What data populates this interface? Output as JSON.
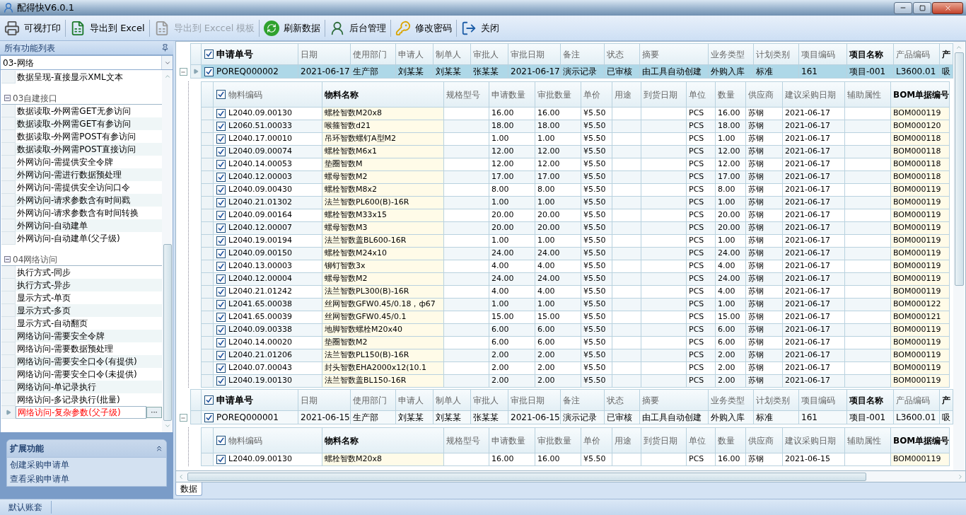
{
  "window": {
    "title": "配得快V6.0.1"
  },
  "toolbar": [
    {
      "kind": "print",
      "label": "可视打印",
      "disabled": false
    },
    {
      "kind": "excel",
      "label": "导出到 Excel",
      "disabled": false
    },
    {
      "kind": "excel",
      "label": "导出到 Exccel 模板",
      "disabled": true
    },
    {
      "kind": "refresh",
      "label": "刷新数据",
      "disabled": false
    },
    {
      "kind": "admin",
      "label": "后台管理",
      "disabled": false
    },
    {
      "kind": "key",
      "label": "修改密码",
      "disabled": false
    },
    {
      "kind": "exit",
      "label": "关闭",
      "disabled": false
    }
  ],
  "function_list": {
    "title": "所有功能列表",
    "filter": "03-网络",
    "more_button": "···",
    "sections": [
      {
        "items": [
          {
            "label": "数据呈现-直接显示XML文本",
            "selected": false
          }
        ]
      },
      {
        "title": "03自建接口",
        "expanded": true,
        "items": [
          {
            "label": "数据读取-外网需GET无参访问",
            "selected": false
          },
          {
            "label": "数据读取-外网需GET有参访问",
            "selected": false
          },
          {
            "label": "数据读取-外网需POST有参访问",
            "selected": false
          },
          {
            "label": "数据读取-外网需POST直接访问",
            "selected": false
          },
          {
            "label": "外网访问-需提供安全令牌",
            "selected": false
          },
          {
            "label": "外网访问-需进行数据预处理",
            "selected": false
          },
          {
            "label": "外网访问-需提供安全访问口令",
            "selected": false
          },
          {
            "label": "外网访问-请求参数含有时间戳",
            "selected": false
          },
          {
            "label": "外网访问-请求参数含有时间转换",
            "selected": false
          },
          {
            "label": "外网访问-自动建单",
            "selected": false
          },
          {
            "label": "外网访问-自动建单(父子级)",
            "selected": false
          }
        ]
      },
      {
        "title": "04网络访问",
        "expanded": true,
        "items": [
          {
            "label": "执行方式-同步",
            "selected": false
          },
          {
            "label": "执行方式-异步",
            "selected": false
          },
          {
            "label": "显示方式-单页",
            "selected": false
          },
          {
            "label": "显示方式-多页",
            "selected": false
          },
          {
            "label": "显示方式-自动翻页",
            "selected": false
          },
          {
            "label": "网络访问-需要安全令牌",
            "selected": false
          },
          {
            "label": "网络访问-需要数据预处理",
            "selected": false
          },
          {
            "label": "网络访问-需要安全口令(有提供)",
            "selected": false
          },
          {
            "label": "网络访问-需要安全口令(未提供)",
            "selected": false
          },
          {
            "label": "网络访问-单记录执行",
            "selected": false
          },
          {
            "label": "网络访问-多记录执行(批量)",
            "selected": false
          },
          {
            "label": "网络访问-复杂参数(父子级)",
            "selected": true
          }
        ]
      }
    ]
  },
  "extension_panel": {
    "title": "扩展功能",
    "expanded": true,
    "links": [
      "创建采购申请单",
      "查看采购申请单"
    ]
  },
  "records": [
    {
      "expanded": true,
      "header_checked": true,
      "columns": [
        {
          "label": "申请单号",
          "bold": true
        },
        {
          "label": "日期",
          "bold": false
        },
        {
          "label": "使用部门",
          "bold": false
        },
        {
          "label": "申请人",
          "bold": false
        },
        {
          "label": "制单人",
          "bold": false
        },
        {
          "label": "审批人",
          "bold": false
        },
        {
          "label": "审批日期",
          "bold": false
        },
        {
          "label": "备注",
          "bold": false
        },
        {
          "label": "状态",
          "bold": false
        },
        {
          "label": "摘要",
          "bold": false
        },
        {
          "label": "业务类型",
          "bold": false
        },
        {
          "label": "计划类别",
          "bold": false
        },
        {
          "label": "项目编码",
          "bold": false
        },
        {
          "label": "项目名称",
          "bold": true
        },
        {
          "label": "产品编码",
          "bold": false
        },
        {
          "label": "产",
          "bold": true
        }
      ],
      "row": {
        "selected": true,
        "checked": true,
        "cells": [
          "POREQ000002",
          "2021-06-17",
          "生产部",
          "刘某某",
          "刘某某",
          "张某某",
          "2021-06-17",
          "演示记录",
          "已审核",
          "由工具自动创建",
          "外购入库",
          "标准",
          "161",
          "项目-001",
          "L3600.01",
          "吸"
        ]
      },
      "detail": {
        "header_checked": true,
        "columns": [
          {
            "label": "物料编码",
            "bold": false,
            "highlight": false
          },
          {
            "label": "物料名称",
            "bold": true,
            "highlight": true
          },
          {
            "label": "规格型号",
            "bold": false,
            "highlight": false
          },
          {
            "label": "申请数量",
            "bold": false,
            "highlight": false
          },
          {
            "label": "审批数量",
            "bold": false,
            "highlight": false
          },
          {
            "label": "单价",
            "bold": false,
            "highlight": false
          },
          {
            "label": "用途",
            "bold": false,
            "highlight": false
          },
          {
            "label": "到货日期",
            "bold": false,
            "highlight": false
          },
          {
            "label": "单位",
            "bold": false,
            "highlight": false
          },
          {
            "label": "数量",
            "bold": false,
            "highlight": false
          },
          {
            "label": "供应商",
            "bold": false,
            "highlight": false
          },
          {
            "label": "建议采购日期",
            "bold": false,
            "highlight": false
          },
          {
            "label": "辅助属性",
            "bold": false,
            "highlight": false
          },
          {
            "label": "BOM单据编号",
            "bold": true,
            "highlight": true
          }
        ],
        "rows": [
          {
            "checked": true,
            "cells": [
              "L2040.09.00130",
              "螺栓智数M20x8",
              null,
              "16.00",
              "16.00",
              "¥5.50",
              null,
              null,
              "PCS",
              "16.00",
              "苏钢",
              "2021-06-17",
              null,
              "BOM000119"
            ]
          },
          {
            "checked": true,
            "cells": [
              "L2060.51.00033",
              "喉箍智数d21",
              null,
              "18.00",
              "18.00",
              "¥5.50",
              null,
              null,
              "PCS",
              "18.00",
              "苏钢",
              "2021-06-17",
              null,
              "BOM000120"
            ]
          },
          {
            "checked": true,
            "cells": [
              "L2040.17.00010",
              "吊环智数螺钉A型M2",
              null,
              "1.00",
              "1.00",
              "¥5.50",
              null,
              null,
              "PCS",
              "1.00",
              "苏钢",
              "2021-06-17",
              null,
              "BOM000118"
            ]
          },
          {
            "checked": true,
            "cells": [
              "L2040.09.00074",
              "螺栓智数M6x1",
              null,
              "12.00",
              "12.00",
              "¥5.50",
              null,
              null,
              "PCS",
              "12.00",
              "苏钢",
              "2021-06-17",
              null,
              "BOM000118"
            ]
          },
          {
            "checked": true,
            "cells": [
              "L2040.14.00053",
              "垫圈智数M",
              null,
              "12.00",
              "12.00",
              "¥5.50",
              null,
              null,
              "PCS",
              "12.00",
              "苏钢",
              "2021-06-17",
              null,
              "BOM000118"
            ]
          },
          {
            "checked": true,
            "cells": [
              "L2040.12.00003",
              "螺母智数M2",
              null,
              "17.00",
              "17.00",
              "¥5.50",
              null,
              null,
              "PCS",
              "17.00",
              "苏钢",
              "2021-06-17",
              null,
              "BOM000118"
            ]
          },
          {
            "checked": true,
            "cells": [
              "L2040.09.00430",
              "螺栓智数M8x2",
              null,
              "8.00",
              "8.00",
              "¥5.50",
              null,
              null,
              "PCS",
              "8.00",
              "苏钢",
              "2021-06-17",
              null,
              "BOM000119"
            ]
          },
          {
            "checked": true,
            "cells": [
              "L2040.21.01302",
              "法兰智数PL600(B)-16R",
              null,
              "1.00",
              "1.00",
              "¥5.50",
              null,
              null,
              "PCS",
              "1.00",
              "苏钢",
              "2021-06-17",
              null,
              "BOM000119"
            ]
          },
          {
            "checked": true,
            "cells": [
              "L2040.09.00164",
              "螺栓智数M33x15",
              null,
              "20.00",
              "20.00",
              "¥5.50",
              null,
              null,
              "PCS",
              "20.00",
              "苏钢",
              "2021-06-17",
              null,
              "BOM000119"
            ]
          },
          {
            "checked": true,
            "cells": [
              "L2040.12.00007",
              "螺母智数M3",
              null,
              "20.00",
              "20.00",
              "¥5.50",
              null,
              null,
              "PCS",
              "20.00",
              "苏钢",
              "2021-06-17",
              null,
              "BOM000119"
            ]
          },
          {
            "checked": true,
            "cells": [
              "L2040.19.00194",
              "法兰智数盖BL600-16R",
              null,
              "1.00",
              "1.00",
              "¥5.50",
              null,
              null,
              "PCS",
              "1.00",
              "苏钢",
              "2021-06-17",
              null,
              "BOM000119"
            ]
          },
          {
            "checked": true,
            "cells": [
              "L2040.09.00150",
              "螺栓智数M24x10",
              null,
              "24.00",
              "24.00",
              "¥5.50",
              null,
              null,
              "PCS",
              "24.00",
              "苏钢",
              "2021-06-17",
              null,
              "BOM000119"
            ]
          },
          {
            "checked": true,
            "cells": [
              "L2040.13.00003",
              "铆钉智数3x",
              null,
              "4.00",
              "4.00",
              "¥5.50",
              null,
              null,
              "PCS",
              "4.00",
              "苏钢",
              "2021-06-17",
              null,
              "BOM000119"
            ]
          },
          {
            "checked": true,
            "cells": [
              "L2040.12.00004",
              "螺母智数M2",
              null,
              "24.00",
              "24.00",
              "¥5.50",
              null,
              null,
              "PCS",
              "24.00",
              "苏钢",
              "2021-06-17",
              null,
              "BOM000119"
            ]
          },
          {
            "checked": true,
            "cells": [
              "L2040.21.01242",
              "法兰智数PL300(B)-16R",
              null,
              "4.00",
              "4.00",
              "¥5.50",
              null,
              null,
              "PCS",
              "4.00",
              "苏钢",
              "2021-06-17",
              null,
              "BOM000119"
            ]
          },
          {
            "checked": true,
            "cells": [
              "L2041.65.00038",
              "丝网智数GFW0.45/0.18，ф67",
              null,
              "1.00",
              "1.00",
              "¥5.50",
              null,
              null,
              "PCS",
              "1.00",
              "苏钢",
              "2021-06-17",
              null,
              "BOM000122"
            ]
          },
          {
            "checked": true,
            "cells": [
              "L2041.65.00039",
              "丝网智数GFW0.45/0.1",
              null,
              "15.00",
              "15.00",
              "¥5.50",
              null,
              null,
              "PCS",
              "15.00",
              "苏钢",
              "2021-06-17",
              null,
              "BOM000121"
            ]
          },
          {
            "checked": true,
            "cells": [
              "L2040.09.00338",
              "地脚智数螺栓M20x40",
              null,
              "6.00",
              "6.00",
              "¥5.50",
              null,
              null,
              "PCS",
              "6.00",
              "苏钢",
              "2021-06-17",
              null,
              "BOM000119"
            ]
          },
          {
            "checked": true,
            "cells": [
              "L2040.14.00020",
              "垫圈智数M2",
              null,
              "6.00",
              "6.00",
              "¥5.50",
              null,
              null,
              "PCS",
              "6.00",
              "苏钢",
              "2021-06-17",
              null,
              "BOM000119"
            ]
          },
          {
            "checked": true,
            "cells": [
              "L2040.21.01206",
              "法兰智数PL150(B)-16R",
              null,
              "2.00",
              "2.00",
              "¥5.50",
              null,
              null,
              "PCS",
              "2.00",
              "苏钢",
              "2021-06-17",
              null,
              "BOM000119"
            ]
          },
          {
            "checked": true,
            "cells": [
              "L2040.07.00043",
              "封头智数EHA2000x12(10.1",
              null,
              "2.00",
              "2.00",
              "¥5.50",
              null,
              null,
              "PCS",
              "2.00",
              "苏钢",
              "2021-06-17",
              null,
              "BOM000119"
            ]
          },
          {
            "checked": true,
            "cells": [
              "L2040.19.00130",
              "法兰智数盖BL150-16R",
              null,
              "2.00",
              "2.00",
              "¥5.50",
              null,
              null,
              "PCS",
              "2.00",
              "苏钢",
              "2021-06-17",
              null,
              "BOM000119"
            ]
          }
        ]
      }
    },
    {
      "expanded": true,
      "header_checked": true,
      "columns": [
        {
          "label": "申请单号",
          "bold": true
        },
        {
          "label": "日期",
          "bold": false
        },
        {
          "label": "使用部门",
          "bold": false
        },
        {
          "label": "申请人",
          "bold": false
        },
        {
          "label": "制单人",
          "bold": false
        },
        {
          "label": "审批人",
          "bold": false
        },
        {
          "label": "审批日期",
          "bold": false
        },
        {
          "label": "备注",
          "bold": false
        },
        {
          "label": "状态",
          "bold": false
        },
        {
          "label": "摘要",
          "bold": false
        },
        {
          "label": "业务类型",
          "bold": false
        },
        {
          "label": "计划类别",
          "bold": false
        },
        {
          "label": "项目编码",
          "bold": false
        },
        {
          "label": "项目名称",
          "bold": true
        },
        {
          "label": "产品编码",
          "bold": false
        },
        {
          "label": "产",
          "bold": true
        }
      ],
      "row": {
        "selected": false,
        "checked": true,
        "cells": [
          "POREQ000001",
          "2021-06-15",
          "生产部",
          "刘某某",
          "刘某某",
          "张某某",
          "2021-06-15",
          "演示记录",
          "已审核",
          "由工具自动创建",
          "外购入库",
          "标准",
          "161",
          "项目-001",
          "L3600.01",
          "吸"
        ]
      },
      "detail": {
        "header_checked": true,
        "columns": [
          {
            "label": "物料编码",
            "bold": false,
            "highlight": false
          },
          {
            "label": "物料名称",
            "bold": true,
            "highlight": true
          },
          {
            "label": "规格型号",
            "bold": false,
            "highlight": false
          },
          {
            "label": "申请数量",
            "bold": false,
            "highlight": false
          },
          {
            "label": "审批数量",
            "bold": false,
            "highlight": false
          },
          {
            "label": "单价",
            "bold": false,
            "highlight": false
          },
          {
            "label": "用途",
            "bold": false,
            "highlight": false
          },
          {
            "label": "到货日期",
            "bold": false,
            "highlight": false
          },
          {
            "label": "单位",
            "bold": false,
            "highlight": false
          },
          {
            "label": "数量",
            "bold": false,
            "highlight": false
          },
          {
            "label": "供应商",
            "bold": false,
            "highlight": false
          },
          {
            "label": "建议采购日期",
            "bold": false,
            "highlight": false
          },
          {
            "label": "辅助属性",
            "bold": false,
            "highlight": false
          },
          {
            "label": "BOM单据编号",
            "bold": true,
            "highlight": true
          }
        ],
        "rows": [
          {
            "checked": true,
            "cells": [
              "L2040.09.00130",
              "螺栓智数M20x8",
              null,
              "16.00",
              "16.00",
              "¥5.50",
              null,
              null,
              "PCS",
              "16.00",
              "苏钢",
              "2021-06-15",
              null,
              "BOM000119"
            ]
          }
        ]
      }
    }
  ],
  "tabs": [
    {
      "label": "数据",
      "selected": true
    }
  ],
  "status_bar": {
    "account": "默认账套"
  }
}
